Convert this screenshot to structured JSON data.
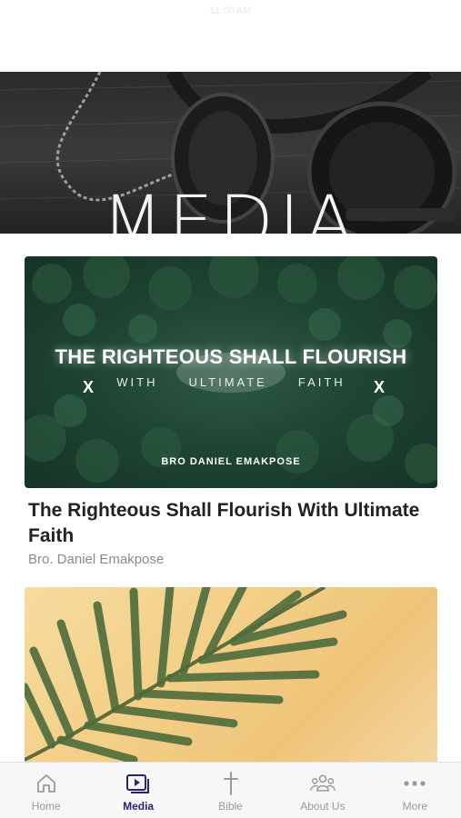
{
  "status_bar": {
    "time": "11:00 AM"
  },
  "hero": {
    "title": "MEDIA"
  },
  "sermons": [
    {
      "thumbnail": {
        "title": "THE RIGHTEOUS SHALL FLOURISH",
        "subtitle_words": [
          "WITH",
          "ULTIMATE",
          "FAITH"
        ],
        "mark": "X",
        "speaker": "BRO DANIEL EMAKPOSE"
      },
      "title": "The Righteous Shall Flourish With Ultimate Faith",
      "speaker": "Bro. Daniel Emakpose"
    }
  ],
  "tab_bar": {
    "active_color": "#2b2270",
    "inactive_color": "#9a9a9a",
    "tabs": [
      {
        "label": "Home",
        "icon": "home-icon",
        "active": false
      },
      {
        "label": "Media",
        "icon": "media-play-icon",
        "active": true
      },
      {
        "label": "Bible",
        "icon": "cross-icon",
        "active": false
      },
      {
        "label": "About Us",
        "icon": "people-icon",
        "active": false
      },
      {
        "label": "More",
        "icon": "more-dots-icon",
        "active": false
      }
    ]
  }
}
